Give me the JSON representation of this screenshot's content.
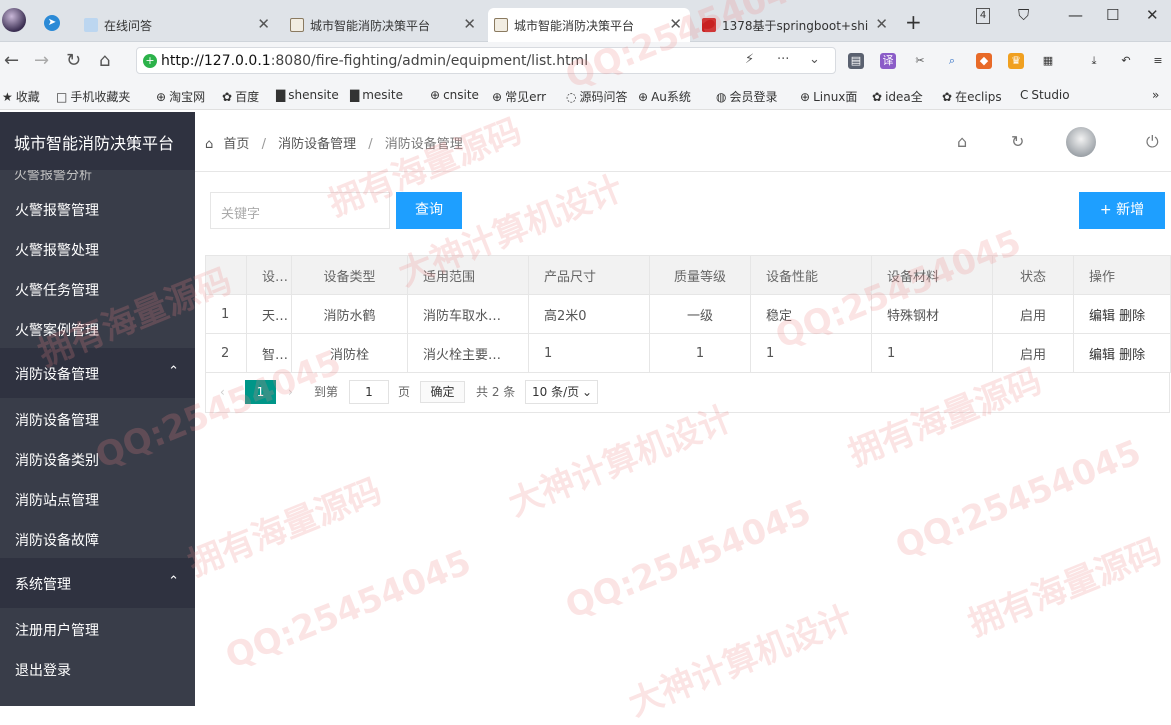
{
  "browser": {
    "tabs": [
      {
        "title": "在线问答",
        "color": "#5aa0e0"
      },
      {
        "title": "城市智能消防决策平台",
        "color": "#8a7a60"
      },
      {
        "title": "城市智能消防决策平台",
        "color": "#8a7a60"
      },
      {
        "title": "1378基于springboot+shi",
        "color": "#c82020"
      }
    ],
    "tab_count": "4",
    "url_prefix": "http://127.0.0.1",
    "url_rest": ":8080/fire-fighting/admin/equipment/list.html",
    "bookmarks": [
      {
        "icon": "★",
        "label": "收藏"
      },
      {
        "icon": "□",
        "label": "手机收藏夹"
      },
      {
        "icon": "⊕",
        "label": "淘宝网"
      },
      {
        "icon": "✿",
        "label": "百度"
      },
      {
        "icon": "▇",
        "label": "shensite"
      },
      {
        "icon": "▇",
        "label": "mesite"
      },
      {
        "icon": "⊕",
        "label": "cnsite"
      },
      {
        "icon": "⊕",
        "label": "常见err"
      },
      {
        "icon": "◌",
        "label": "源码问答"
      },
      {
        "icon": "⊕",
        "label": "Au系统"
      },
      {
        "icon": "◍",
        "label": "会员登录"
      },
      {
        "icon": "⊕",
        "label": "Linux面"
      },
      {
        "icon": "✿",
        "label": "idea全"
      },
      {
        "icon": "✿",
        "label": "在eclips"
      },
      {
        "icon": "C",
        "label": "Studio"
      }
    ]
  },
  "sidebar": {
    "brand": "城市智能消防决策平台",
    "cut_item": "火警报警分析",
    "items": [
      {
        "label": "火警报警管理",
        "group": false
      },
      {
        "label": "火警报警处理",
        "group": false
      },
      {
        "label": "火警任务管理",
        "group": false
      },
      {
        "label": "火警案例管理",
        "group": false
      },
      {
        "label": "消防设备管理",
        "group": true
      },
      {
        "label": "消防设备管理",
        "group": false
      },
      {
        "label": "消防设备类别",
        "group": false
      },
      {
        "label": "消防站点管理",
        "group": false
      },
      {
        "label": "消防设备故障",
        "group": false
      },
      {
        "label": "系统管理",
        "group": true
      },
      {
        "label": "注册用户管理",
        "group": false
      },
      {
        "label": "退出登录",
        "group": false
      }
    ]
  },
  "breadcrumb": {
    "home": "首页",
    "level1": "消防设备管理",
    "level2": "消防设备管理"
  },
  "search": {
    "placeholder": "关键字",
    "button": "查询",
    "add_button": "+ 新增"
  },
  "table": {
    "headers": [
      "",
      "设备名称",
      "设备类型",
      "适用范围",
      "产品尺寸",
      "质量等级",
      "设备性能",
      "设备材料",
      "状态",
      "操作"
    ],
    "rows": [
      {
        "no": "1",
        "name": "天津消防水鹤",
        "type": "消防水鹤",
        "scope": "消防车取水加水使用",
        "size": "高2米0",
        "grade": "一级",
        "perf": "稳定",
        "material": "特殊钢材",
        "status": "启用",
        "edit": "编辑",
        "del": "删除"
      },
      {
        "no": "2",
        "name": "智能消防栓",
        "type": "消防栓",
        "scope": "消火栓主要供消防车取水",
        "size": "1",
        "grade": "1",
        "perf": "1",
        "material": "1",
        "status": "启用",
        "edit": "编辑",
        "del": "删除"
      }
    ]
  },
  "pagination": {
    "current": "1",
    "goto": "到第",
    "page_input": "1",
    "page_unit": "页",
    "confirm": "确定",
    "total": "共 2 条",
    "per_page": "10 条/页"
  },
  "watermarks": [
    "QQ:25454045",
    "拥有海量源码",
    "大神计算机设计"
  ]
}
